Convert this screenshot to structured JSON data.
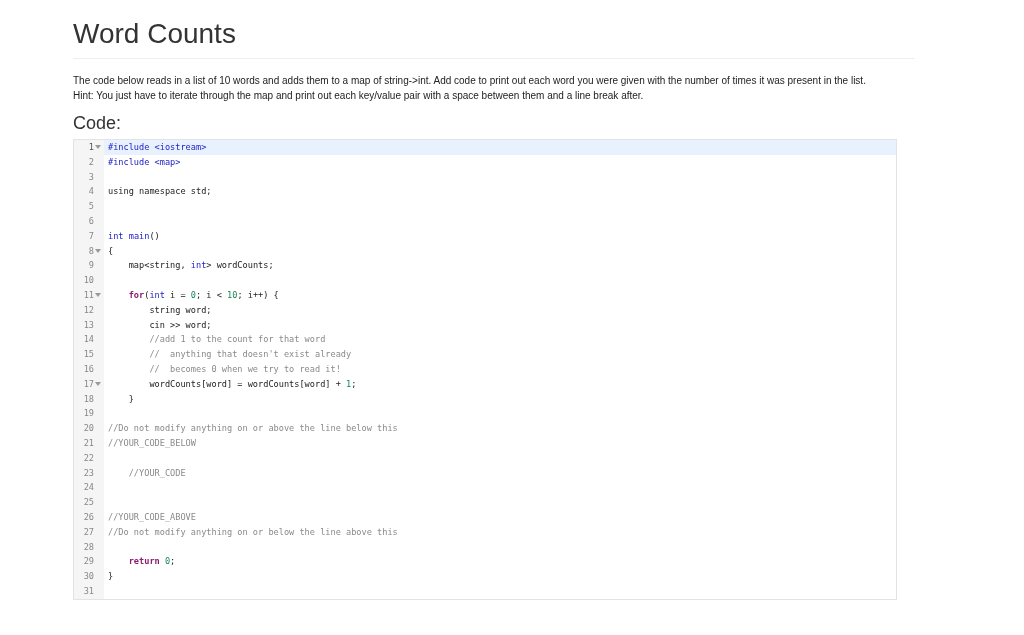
{
  "title": "Word Counts",
  "description": [
    "The code below reads in a list of 10 words and adds them to a map of string->int. Add code to print out each word you were given with the number of times it was present in the list.",
    "Hint: You just have to iterate through the map and print out each key/value pair with a space between them and a line break after."
  ],
  "code_heading": "Code:",
  "editor": {
    "lines": [
      {
        "number": "1",
        "foldable": true,
        "active": true,
        "tokens": [
          {
            "kind": "directive",
            "text": "#include <iostream>"
          }
        ]
      },
      {
        "number": "2",
        "foldable": false,
        "active": false,
        "tokens": [
          {
            "kind": "directive",
            "text": "#include <map>"
          }
        ]
      },
      {
        "number": "3",
        "foldable": false,
        "active": false
      },
      {
        "number": "4",
        "foldable": false,
        "active": false,
        "tokens": [
          {
            "kind": "plain",
            "text": "using namespace std;"
          }
        ]
      },
      {
        "number": "5",
        "foldable": false,
        "active": false
      },
      {
        "number": "6",
        "foldable": false,
        "active": false
      },
      {
        "number": "7",
        "foldable": false,
        "active": false,
        "tokens": [
          {
            "kind": "type",
            "text": "int"
          },
          {
            "kind": "type",
            "text": " main"
          },
          {
            "kind": "plain",
            "text": "()"
          }
        ]
      },
      {
        "number": "8",
        "foldable": true,
        "active": false,
        "tokens": [
          {
            "kind": "plain",
            "text": "{"
          }
        ]
      },
      {
        "number": "9",
        "foldable": false,
        "active": false,
        "tokens": [
          {
            "kind": "plain",
            "text": "    map<string, "
          },
          {
            "kind": "type",
            "text": "int"
          },
          {
            "kind": "plain",
            "text": "> wordCounts;"
          }
        ]
      },
      {
        "number": "10",
        "foldable": false,
        "active": false
      },
      {
        "number": "11",
        "foldable": true,
        "active": false,
        "tokens": [
          {
            "kind": "keyword",
            "text": "    for"
          },
          {
            "kind": "plain",
            "text": "("
          },
          {
            "kind": "type",
            "text": "int"
          },
          {
            "kind": "plain",
            "text": " i = "
          },
          {
            "kind": "number",
            "text": "0"
          },
          {
            "kind": "plain",
            "text": "; i < "
          },
          {
            "kind": "number",
            "text": "10"
          },
          {
            "kind": "plain",
            "text": "; i++) {"
          }
        ]
      },
      {
        "number": "12",
        "foldable": false,
        "active": false,
        "tokens": [
          {
            "kind": "plain",
            "text": "        string word;"
          }
        ]
      },
      {
        "number": "13",
        "foldable": false,
        "active": false,
        "tokens": [
          {
            "kind": "plain",
            "text": "        cin >> word;"
          }
        ]
      },
      {
        "number": "14",
        "foldable": false,
        "active": false,
        "tokens": [
          {
            "kind": "comment",
            "text": "        //add 1 to the count for that word"
          }
        ]
      },
      {
        "number": "15",
        "foldable": false,
        "active": false,
        "tokens": [
          {
            "kind": "comment",
            "text": "        //  anything that doesn't exist already"
          }
        ]
      },
      {
        "number": "16",
        "foldable": false,
        "active": false,
        "tokens": [
          {
            "kind": "comment",
            "text": "        //  becomes 0 when we try to read it!"
          }
        ]
      },
      {
        "number": "17",
        "foldable": true,
        "active": false,
        "tokens": [
          {
            "kind": "plain",
            "text": "        wordCounts[word] = wordCounts[word] + "
          },
          {
            "kind": "number",
            "text": "1"
          },
          {
            "kind": "plain",
            "text": ";"
          }
        ]
      },
      {
        "number": "18",
        "foldable": false,
        "active": false,
        "tokens": [
          {
            "kind": "plain",
            "text": "    }"
          }
        ]
      },
      {
        "number": "19",
        "foldable": false,
        "active": false
      },
      {
        "number": "20",
        "foldable": false,
        "active": false,
        "tokens": [
          {
            "kind": "comment",
            "text": "//Do not modify anything on or above the line below this"
          }
        ]
      },
      {
        "number": "21",
        "foldable": false,
        "active": false,
        "tokens": [
          {
            "kind": "comment",
            "text": "//YOUR_CODE_BELOW"
          }
        ]
      },
      {
        "number": "22",
        "foldable": false,
        "active": false
      },
      {
        "number": "23",
        "foldable": false,
        "active": false,
        "tokens": [
          {
            "kind": "comment",
            "text": "    //YOUR_CODE"
          }
        ]
      },
      {
        "number": "24",
        "foldable": false,
        "active": false
      },
      {
        "number": "25",
        "foldable": false,
        "active": false
      },
      {
        "number": "26",
        "foldable": false,
        "active": false,
        "tokens": [
          {
            "kind": "comment",
            "text": "//YOUR_CODE_ABOVE"
          }
        ]
      },
      {
        "number": "27",
        "foldable": false,
        "active": false,
        "tokens": [
          {
            "kind": "comment",
            "text": "//Do not modify anything on or below the line above this"
          }
        ]
      },
      {
        "number": "28",
        "foldable": false,
        "active": false
      },
      {
        "number": "29",
        "foldable": false,
        "active": false,
        "tokens": [
          {
            "kind": "keyword",
            "text": "    return"
          },
          {
            "kind": "number",
            "text": " 0"
          },
          {
            "kind": "plain",
            "text": ";"
          }
        ]
      },
      {
        "number": "30",
        "foldable": false,
        "active": false,
        "tokens": [
          {
            "kind": "plain",
            "text": "}"
          }
        ]
      },
      {
        "number": "31",
        "foldable": false,
        "active": false
      }
    ]
  }
}
